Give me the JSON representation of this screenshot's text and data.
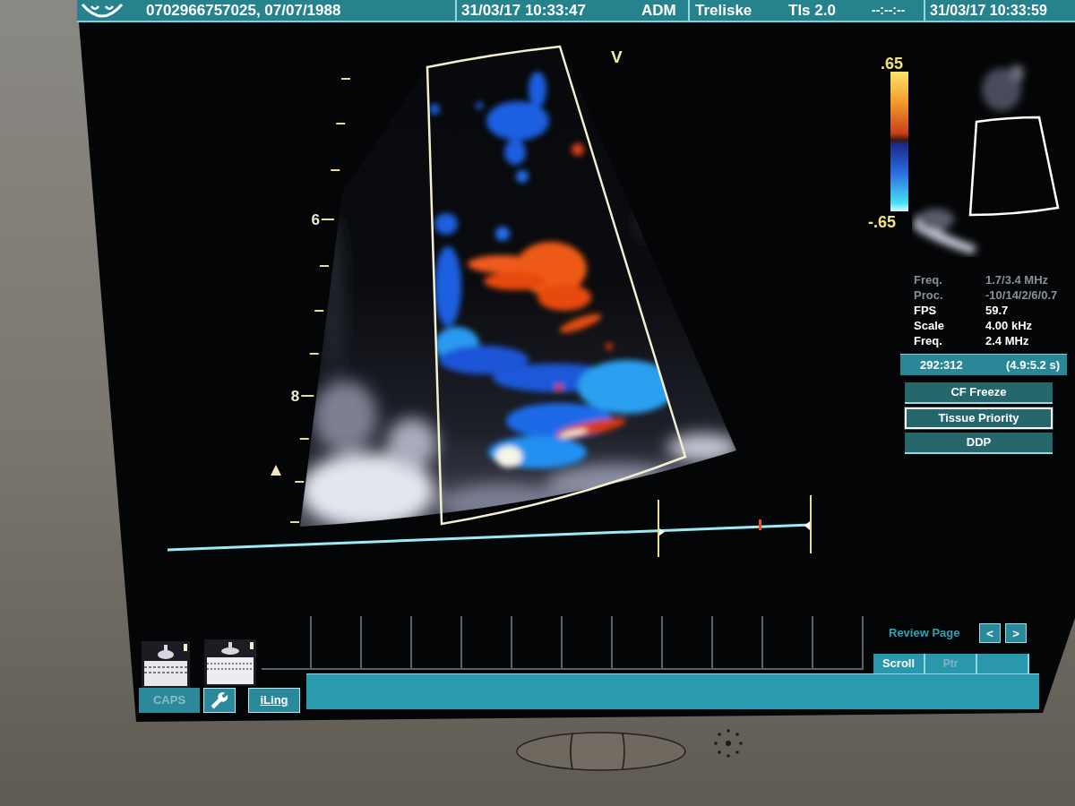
{
  "header": {
    "patient": "0702966757025, 07/07/1988",
    "acquired": "31/03/17 10:33:47",
    "operator": "ADM",
    "institution": "Treliske",
    "thermal_index": "Tls 2.0",
    "timer": "--:--:--",
    "clock": "31/03/17 10:33:59"
  },
  "image": {
    "color_box_label": "V",
    "depth_labels": [
      "6",
      "8"
    ]
  },
  "color_scale": {
    "top": ".65",
    "bottom": "-.65"
  },
  "parameters": [
    {
      "label": "Freq.",
      "value": "1.7/3.4 MHz",
      "dimmed": true
    },
    {
      "label": "Proc.",
      "value": "-10/14/2/6/0.7",
      "dimmed": true
    },
    {
      "label": "FPS",
      "value": "59.7",
      "dimmed": false
    },
    {
      "label": "Scale",
      "value": "4.00 kHz",
      "dimmed": false
    },
    {
      "label": "Freq.",
      "value": "2.4 MHz",
      "dimmed": false
    }
  ],
  "cine": {
    "frames": "292:312",
    "time_range": "(4.9:5.2 s)"
  },
  "buttons": [
    {
      "label": "CF Freeze",
      "selected": false
    },
    {
      "label": "Tissue Priority",
      "selected": true
    },
    {
      "label": "DDP",
      "selected": false
    }
  ],
  "review": {
    "label": "Review Page",
    "previous": "<",
    "next": ">"
  },
  "tabs": [
    {
      "label": "Scroll",
      "selected": true
    },
    {
      "label": "Ptr",
      "selected": false
    }
  ],
  "toolbar": [
    {
      "kind": "indicator",
      "label": "CAPS",
      "on": false
    },
    {
      "kind": "tool"
    },
    {
      "kind": "button",
      "label": "iLing"
    }
  ]
}
